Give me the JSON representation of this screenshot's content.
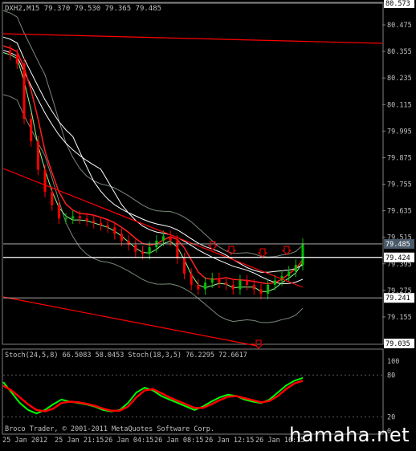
{
  "main_header": "DXH2,M15  79.370 79.530 79.365 79.485",
  "sub_header": "Stoch(24,5,8) 66.5083 58.0453  Stoch(18,3,5) 76.2295 72.6617",
  "copyright": "Broco Trader, © 2001-2011 MetaQuotes Software Corp.",
  "watermark": "hamaha.net",
  "x_tick_labels": [
    "25 Jan 2012",
    "25 Jan 21:15",
    "26 Jan 04:15",
    "26 Jan 08:15",
    "26 Jan 12:15",
    "26 Jan 16:15"
  ],
  "price_tick_labels": [
    "80.475",
    "80.355",
    "80.235",
    "80.115",
    "79.995",
    "79.875",
    "79.755",
    "79.635",
    "79.515",
    "79.395",
    "79.275",
    "79.155"
  ],
  "price_markers": {
    "top": "80.573",
    "ask": "79.485",
    "bid": "79.424",
    "low": "79.241",
    "bottom": "79.035"
  },
  "stoch_tick_labels": [
    "100",
    "80",
    "20",
    "0"
  ],
  "colors": {
    "background": "#000000",
    "candle_up": "#00c000",
    "candle_down": "#ff0000",
    "trendline": "#ff0000",
    "envelope": "#7a8a7a",
    "ma_fast": "#ff2020",
    "ma_slow": "#ffffff",
    "stoch_main": "#00ff00",
    "stoch_signal": "#ff0000",
    "grid": "#5a5a5a",
    "arrow": "#ff0000"
  },
  "chart_data": {
    "type": "line",
    "symbol": "DXH2",
    "timeframe": "M15",
    "ylim": [
      79.035,
      80.573
    ],
    "ohlc_last": {
      "open": 79.37,
      "high": 79.53,
      "low": 79.365,
      "close": 79.485
    },
    "price_path_approx": [
      80.36,
      80.34,
      80.3,
      80.05,
      79.95,
      79.82,
      79.72,
      79.66,
      79.6,
      79.6,
      79.61,
      79.6,
      79.59,
      79.58,
      79.57,
      79.56,
      79.53,
      79.5,
      79.48,
      79.45,
      79.44,
      79.47,
      79.5,
      79.52,
      79.5,
      79.42,
      79.35,
      79.3,
      79.28,
      79.31,
      79.33,
      79.31,
      79.3,
      79.28,
      79.32,
      79.3,
      79.28,
      79.26,
      79.3,
      79.32,
      79.34,
      79.36,
      79.39,
      79.485
    ],
    "stoch_series": [
      {
        "values": [
          70,
          55,
          40,
          30,
          25,
          30,
          38,
          45,
          42,
          40,
          38,
          35,
          30,
          28,
          30,
          40,
          55,
          62,
          58,
          50,
          45,
          40,
          35,
          30,
          35,
          42,
          48,
          52,
          50,
          45,
          42,
          40,
          45,
          55,
          65,
          72,
          76
        ]
      },
      {
        "values": [
          65,
          58,
          48,
          38,
          30,
          28,
          32,
          40,
          42,
          41,
          39,
          36,
          32,
          29,
          29,
          35,
          48,
          58,
          60,
          54,
          48,
          43,
          38,
          33,
          33,
          38,
          44,
          49,
          50,
          47,
          44,
          41,
          43,
          50,
          60,
          68,
          72
        ]
      }
    ],
    "stoch_ylim": [
      0,
      100
    ],
    "stoch_levels": [
      20,
      80
    ]
  }
}
